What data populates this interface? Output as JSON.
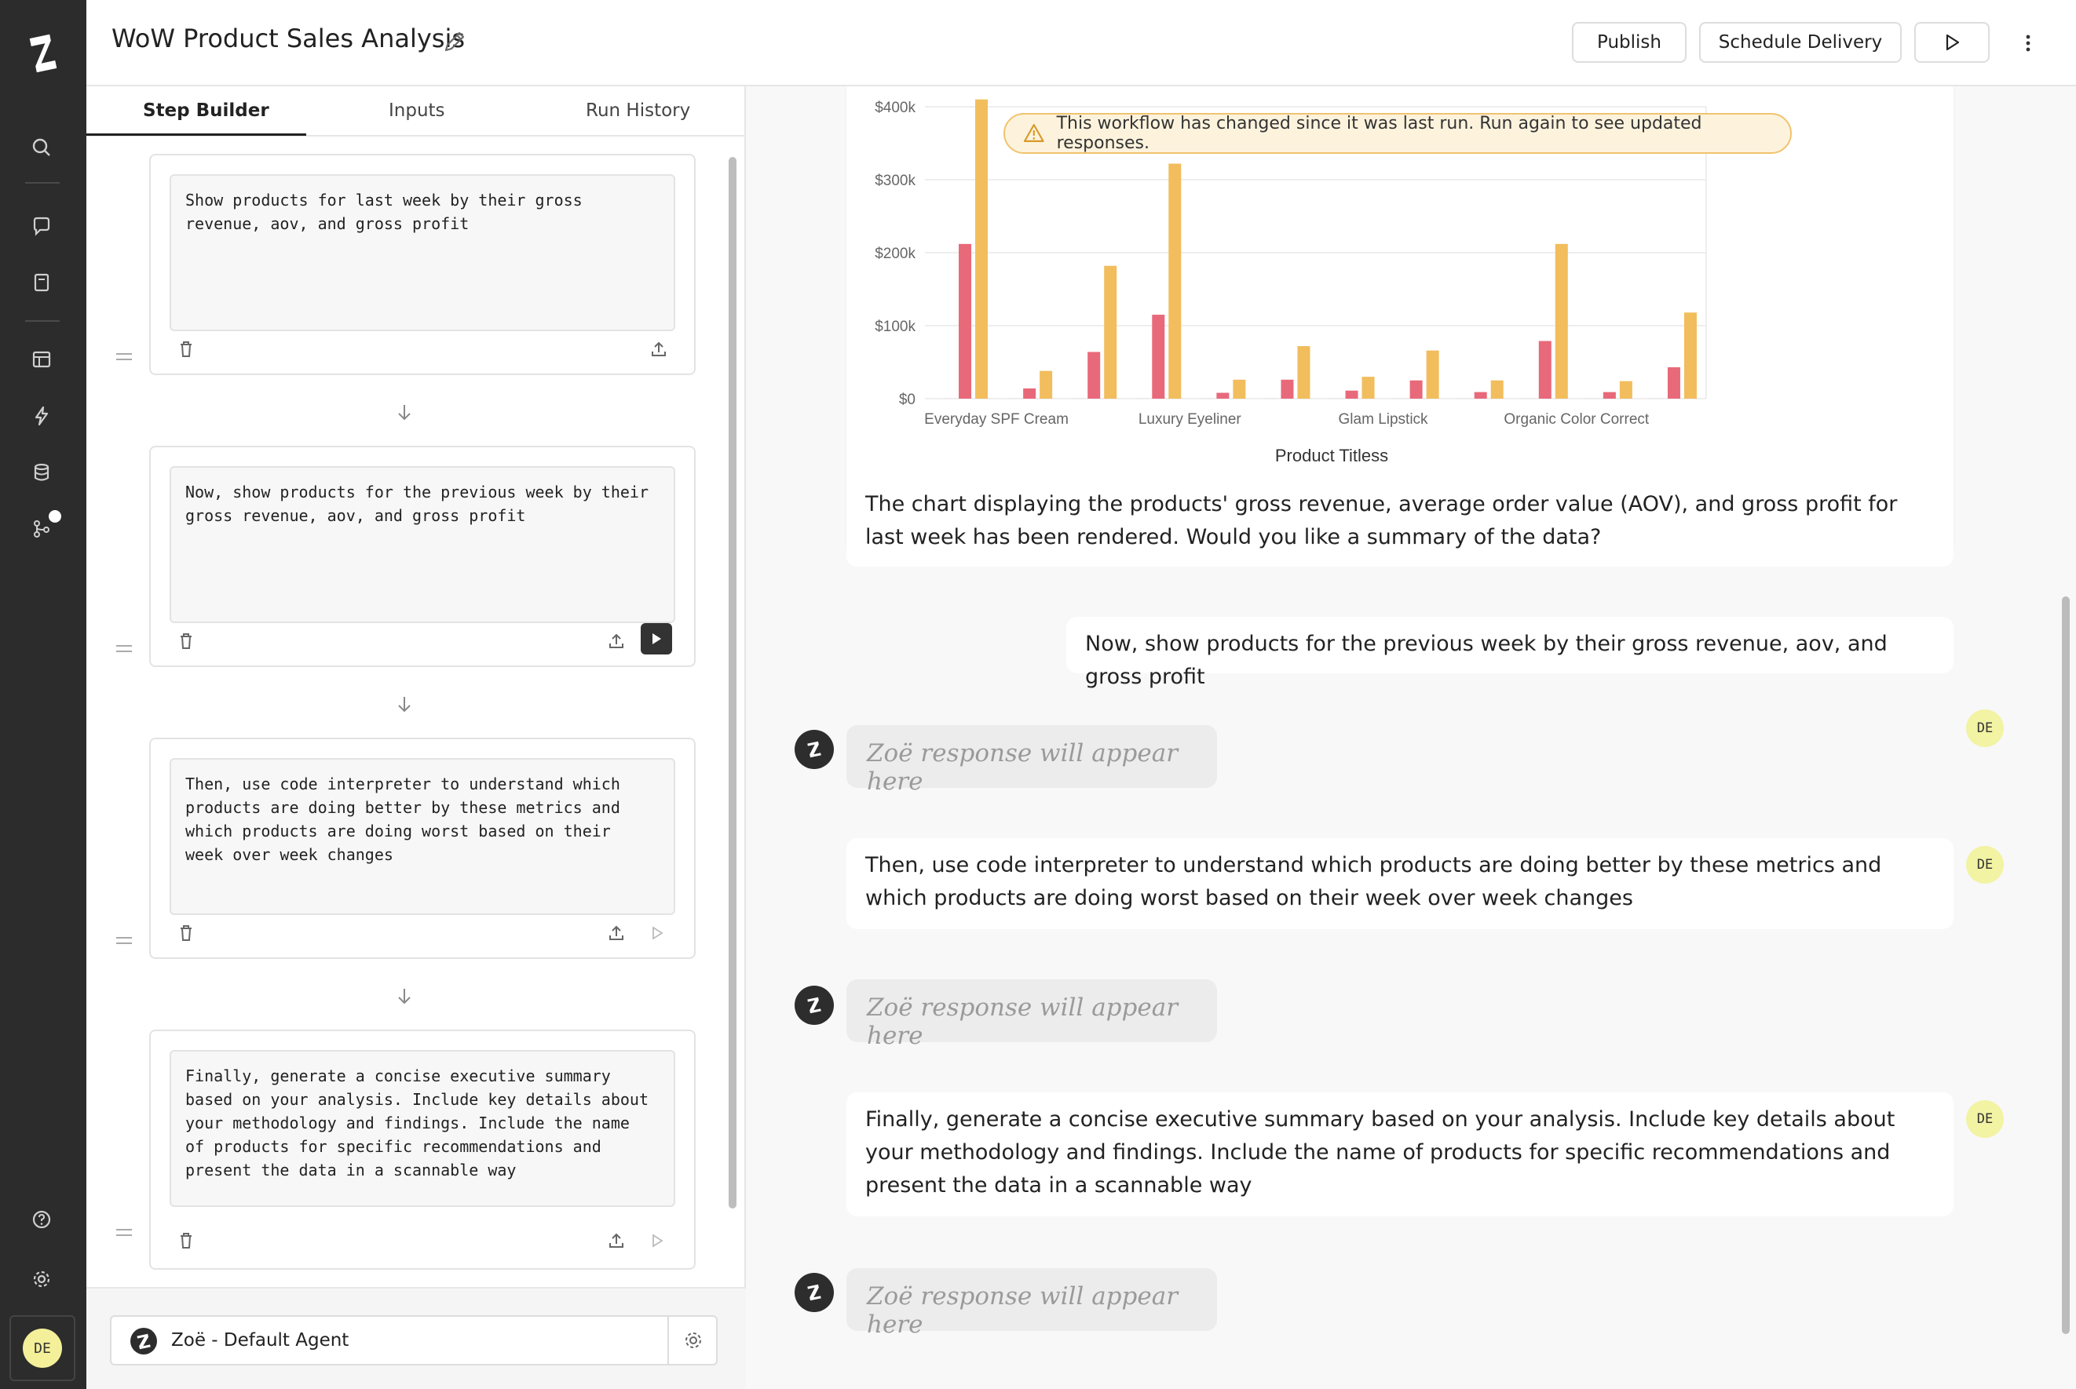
{
  "header": {
    "title": "WoW Product Sales Analysis",
    "publish_label": "Publish",
    "schedule_label": "Schedule Delivery"
  },
  "sidebar": {
    "icons": [
      "search-icon",
      "chat-icon",
      "saved-icon",
      "table-icon",
      "bolt-icon",
      "database-icon",
      "workflow-icon",
      "help-icon",
      "settings-icon"
    ],
    "avatar_initials": "DE"
  },
  "builder": {
    "tabs": [
      {
        "label": "Step Builder",
        "active": true
      },
      {
        "label": "Inputs",
        "active": false
      },
      {
        "label": "Run History",
        "active": false
      }
    ],
    "steps": [
      {
        "prompt": "Show products for last week by their gross\nrevenue, aov, and gross profit"
      },
      {
        "prompt": "Now, show products for the previous week by their\ngross revenue, aov, and gross profit"
      },
      {
        "prompt": "Then, use code interpreter to understand which\nproducts are doing better by these metrics and\nwhich products are doing worst based on their\nweek over week changes"
      },
      {
        "prompt": "Finally, generate a concise executive summary\nbased on your analysis. Include key details about\nyour methodology and findings. Include the name\nof products for specific recommendations and\npresent the data in a scannable way"
      }
    ],
    "agent_label": "Zoë - Default Agent"
  },
  "conversation": {
    "banner": "This workflow has changed since it was last run. Run again to see updated responses.",
    "assistant_reply_1": "The chart displaying the products' gross revenue, average order value (AOV), and gross profit for last week has been rendered. Would you like a summary of the data?",
    "user_msg_2": "Now, show products for the previous week by their gross revenue, aov, and gross profit",
    "user_msg_3": "Then, use code interpreter to understand which products are doing better by these metrics and which products are doing worst based on their week over week changes",
    "user_msg_4": "Finally, generate a concise executive summary based on your analysis. Include key details about your methodology and findings. Include the name of products for specific recommendations and present the data in a scannable way",
    "placeholder": "Zoë response will appear here",
    "user_initials": "DE"
  },
  "chart_data": {
    "type": "bar",
    "xlabel": "Product Titless",
    "ylabel": "",
    "ylim": [
      0,
      400000
    ],
    "y_ticks": [
      "$0",
      "$100k",
      "$200k",
      "$300k",
      "$400k"
    ],
    "x_tick_labels": [
      "Everyday SPF Cream",
      "Luxury Eyeliner",
      "Glam Lipstick",
      "Organic Color Correct"
    ],
    "colors": [
      "#dcdcf0",
      "#e8697a",
      "#f2bd5c"
    ],
    "groups": [
      {
        "values": [
          500,
          212000,
          410000
        ]
      },
      {
        "values": [
          500,
          14000,
          38000
        ]
      },
      {
        "values": [
          500,
          64000,
          182000
        ]
      },
      {
        "values": [
          500,
          115000,
          322000
        ]
      },
      {
        "values": [
          500,
          8000,
          26000
        ]
      },
      {
        "values": [
          500,
          26000,
          72000
        ]
      },
      {
        "values": [
          500,
          11000,
          30000
        ]
      },
      {
        "values": [
          500,
          25000,
          66000
        ]
      },
      {
        "values": [
          500,
          9000,
          25000
        ]
      },
      {
        "values": [
          500,
          79000,
          212000
        ]
      },
      {
        "values": [
          500,
          9000,
          24000
        ]
      },
      {
        "values": [
          500,
          43000,
          118000
        ]
      }
    ]
  }
}
